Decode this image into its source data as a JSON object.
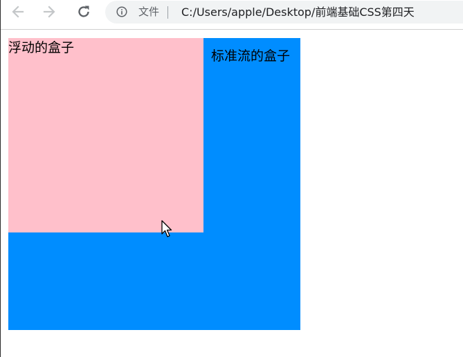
{
  "browser": {
    "security_label": "文件",
    "url": "C:/Users/apple/Desktop/前端基础CSS第四天",
    "icons": {
      "back": "arrow-left-icon",
      "forward": "arrow-right-icon",
      "reload": "reload-icon",
      "info": "info-icon"
    }
  },
  "page": {
    "float_box": {
      "label": "浮动的盒子",
      "color": "#ffc0cb"
    },
    "standard_box": {
      "label": "标准流的盒子",
      "color": "#008dff"
    }
  },
  "cursor": {
    "icon": "mouse-pointer-icon"
  }
}
